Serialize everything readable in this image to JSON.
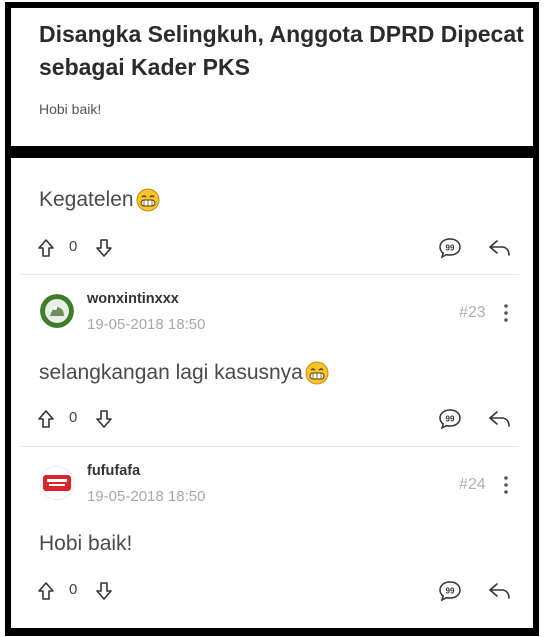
{
  "thread": {
    "title": "Disangka Selingkuh, Anggota DPRD Dipecat sebagai Kader PKS",
    "subtitle": "Hobi baik!"
  },
  "comments": [
    {
      "text": "Kegatelen",
      "emoji": "grinning-emoji",
      "votes": "0"
    },
    {
      "username": "wonxintinxxx",
      "timestamp": "19-05-2018 18:50",
      "post_number": "#23",
      "text": "selangkangan lagi kasusnya",
      "emoji": "grinning-emoji",
      "votes": "0",
      "avatar_color": "#3e7d2c"
    },
    {
      "username": "fufufafa",
      "timestamp": "19-05-2018 18:50",
      "post_number": "#24",
      "text": "Hobi baik!",
      "votes": "0",
      "avatar_color": "#d8262c"
    }
  ],
  "icons": {
    "upvote": "arrow-up-icon",
    "downvote": "arrow-down-icon",
    "quote": "quote-icon",
    "reply": "reply-icon",
    "more": "more-vertical-icon"
  }
}
